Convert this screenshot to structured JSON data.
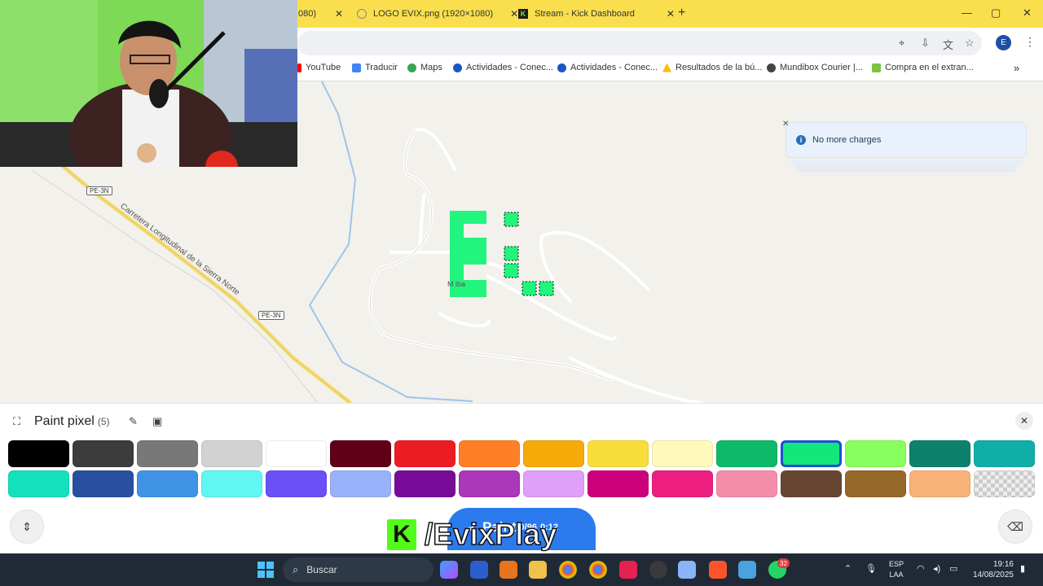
{
  "browser": {
    "tabs": [
      {
        "title": "080)",
        "close": "✕"
      },
      {
        "title": "LOGO EVIX.png (1920×1080)",
        "close": "✕"
      },
      {
        "title": "Stream - Kick Dashboard",
        "close": "✕"
      }
    ],
    "new_tab": "+",
    "window_controls": {
      "minimize": "—",
      "maximize": "▢",
      "close": "✕"
    },
    "profile_initial": "E",
    "bookmarks": [
      {
        "label": "YouTube",
        "icon": "youtube-icon",
        "color": "#ff0000"
      },
      {
        "label": "Traducir",
        "icon": "translate-icon",
        "color": "#4285f4"
      },
      {
        "label": "Maps",
        "icon": "maps-icon",
        "color": "#34a853"
      },
      {
        "label": "Actividades - Conec...",
        "icon": "t-icon",
        "color": "#1a56c4"
      },
      {
        "label": "Actividades - Conec...",
        "icon": "t-icon",
        "color": "#1a56c4"
      },
      {
        "label": "Resultados de la bú...",
        "icon": "drive-icon",
        "color": "#fbbc04"
      },
      {
        "label": "Mundibox Courier |...",
        "icon": "mundibox-icon",
        "color": "#444444"
      },
      {
        "label": "Compra en el extran...",
        "icon": "bag-icon",
        "color": "#7cc242"
      }
    ],
    "bookmarks_more": "»"
  },
  "map": {
    "shields": [
      "PE-3N",
      "PE-3N"
    ],
    "road_name": "Carretera Longitudinal de la Sierra Norte",
    "place_label": "M          iba",
    "painted_letter": "E",
    "pixel_color": "#22f57e"
  },
  "toast": {
    "message": "No more charges",
    "close": "✕",
    "icon": "info-icon"
  },
  "paint_panel": {
    "title": "Paint pixel",
    "count": "(5)",
    "close": "✕",
    "selected_color_index": 12,
    "palette_row1": [
      "#000000",
      "#3c3c3c",
      "#787878",
      "#d2d2d2",
      "#ffffff",
      "#600018",
      "#ed1c24",
      "#ff7f27",
      "#f6aa09",
      "#f9dd3b",
      "#fffabc",
      "#0eb968",
      "#13e67b",
      "#87ff5e",
      "#0c816e",
      "#10aea6"
    ],
    "palette_row2": [
      "#13e1be",
      "#28509e",
      "#4093e4",
      "#60f7f2",
      "#6b50f6",
      "#99b1fb",
      "#780c99",
      "#aa38b9",
      "#e09ff9",
      "#cb007a",
      "#ec1f80",
      "#f38da9",
      "#684634",
      "#95682a",
      "#f8b277",
      "transparent"
    ],
    "paint_button": "Paint",
    "paint_sub": "0/96",
    "paint_timer": "0:12",
    "brand_k": "K",
    "brand_text": "/EvixPlay"
  },
  "taskbar": {
    "search_placeholder": "Buscar",
    "lang_line1": "ESP",
    "lang_line2": "LAA",
    "time": "19:16",
    "date": "14/08/2025",
    "whatsapp_badge": "32"
  }
}
